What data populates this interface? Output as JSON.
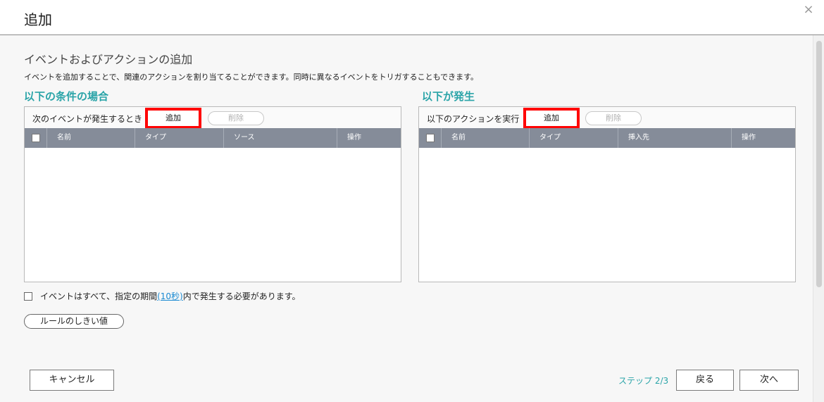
{
  "dialog": {
    "title": "追加",
    "close_glyph": "×"
  },
  "main": {
    "section_title": "イベントおよびアクションの追加",
    "description": "イベントを追加することで、関連のアクションを割り当てることができます。同時に異なるイベントをトリガすることもできます。"
  },
  "left_panel": {
    "heading": "以下の条件の場合",
    "toolbar_label": "次のイベントが発生するとき",
    "add_label": "追加",
    "delete_label": "削除",
    "columns": [
      "名前",
      "タイプ",
      "ソース",
      "操作"
    ]
  },
  "right_panel": {
    "heading": "以下が発生",
    "toolbar_label": "以下のアクションを実行",
    "add_label": "追加",
    "delete_label": "削除",
    "columns": [
      "名前",
      "タイプ",
      "挿入先",
      "操作"
    ]
  },
  "options": {
    "text_before": "イベントはすべて、指定の期間",
    "link": "(10秒)",
    "text_after": "内で発生する必要があります。",
    "rule_button": "ルールのしきい値"
  },
  "footer": {
    "cancel": "キャンセル",
    "step": "ステップ 2/3",
    "back": "戻る",
    "next": "次へ"
  }
}
